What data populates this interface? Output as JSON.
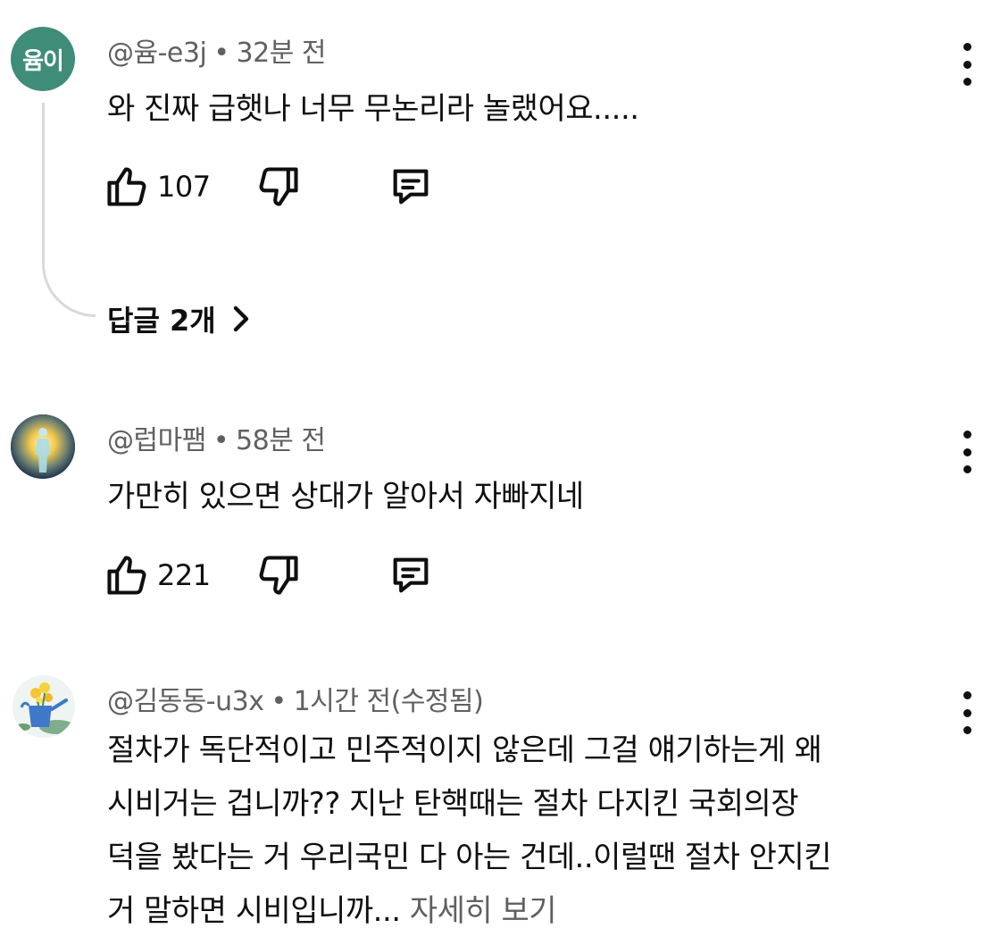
{
  "comments": [
    {
      "avatar_text": "윰이",
      "avatar_color": "#3f8c79",
      "author": "@윰-e3j",
      "time": "32분 전",
      "text": "와 진짜 급햇나 너무 무논리라 놀랬어요.....",
      "likes": "107",
      "replies_label": "답글 2개"
    },
    {
      "avatar_icon": "glowing-figure-icon",
      "author": "@럽마팸",
      "time": "58분 전",
      "text": "가만히 있으면 상대가 알아서 자빠지네",
      "likes": "221"
    },
    {
      "avatar_icon": "flower-watering-can-icon",
      "author": "@김동동-u3x",
      "time": "1시간 전(수정됨)",
      "lines": [
        "절차가 독단적이고 민주적이지 않은데 그걸 얘기하는게 왜",
        "시비거는 겁니까?? 지난 탄핵때는 절차 다지킨 국회의장",
        "덕을 봤다는 거 우리국민 다 아는 건데..이럴땐 절차 안지킨",
        "거 말하면 시비입니까..."
      ],
      "more_label": "자세히 보기"
    }
  ],
  "colors": {
    "text": "#0f0f0f",
    "secondary": "#606060",
    "thread_line": "#d9d9d9"
  }
}
